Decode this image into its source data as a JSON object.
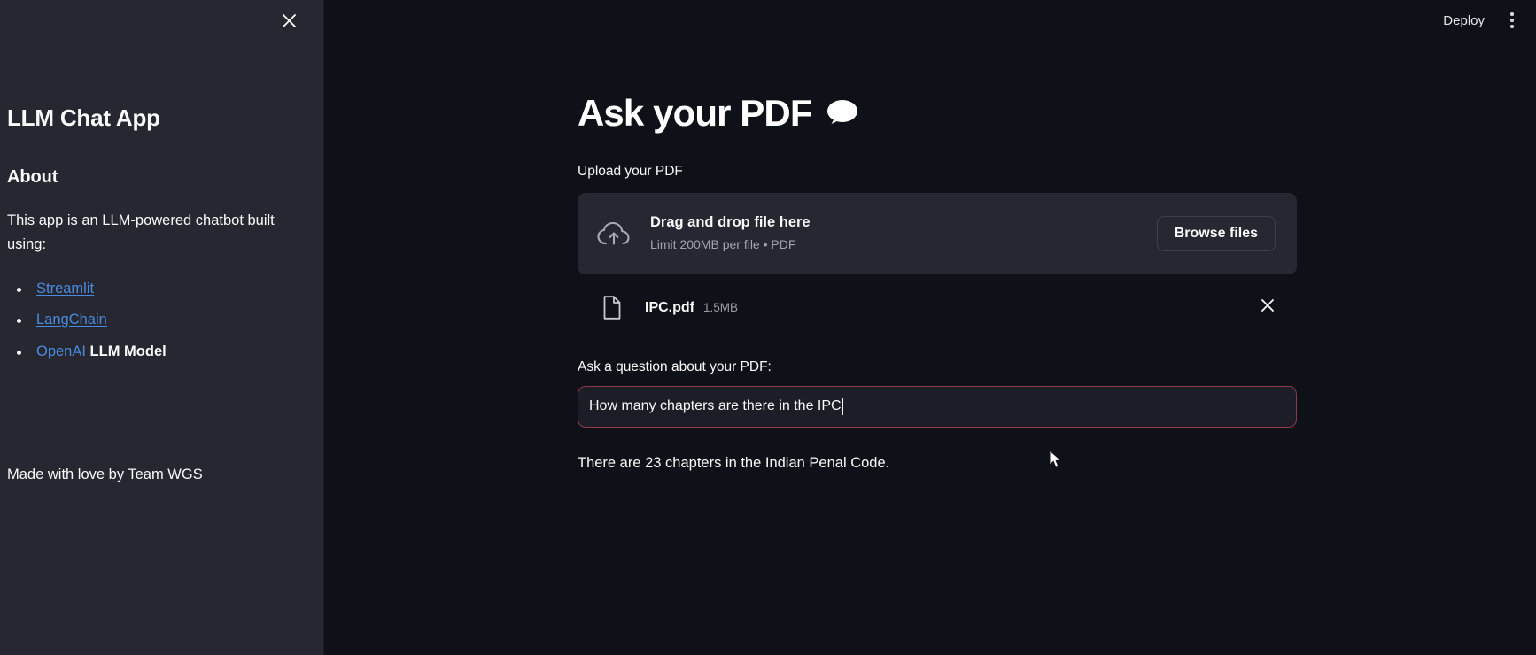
{
  "sidebar": {
    "close_icon": "close-icon",
    "app_title": "LLM Chat App",
    "about_heading": "About",
    "about_text": "This app is an LLM-powered chatbot built using:",
    "links": [
      {
        "label": "Streamlit",
        "suffix": ""
      },
      {
        "label": "LangChain",
        "suffix": ""
      },
      {
        "label": "OpenAI",
        "suffix": " LLM Model"
      }
    ],
    "footer": "Made with love by Team WGS",
    "link_color": "#4a8bdf",
    "background": "#262730"
  },
  "topbar": {
    "deploy_label": "Deploy",
    "menu_icon": "kebab-menu-icon"
  },
  "main": {
    "title": "Ask your PDF",
    "title_icon": "speech-balloon-icon",
    "upload_label": "Upload your PDF",
    "uploader": {
      "icon": "cloud-upload-icon",
      "drag_text": "Drag and drop file here",
      "limit_text": "Limit 200MB per file • PDF",
      "browse_label": "Browse files",
      "background": "#262730"
    },
    "file": {
      "icon": "document-icon",
      "name": "IPC.pdf",
      "size": "1.5MB",
      "remove_icon": "close-icon"
    },
    "question_label": "Ask a question about your PDF:",
    "question_value": "How many chapters are there in the IPC",
    "question_border_color": "#8b3b48",
    "answer": "There are 23 chapters in the Indian Penal Code.",
    "background": "#0e1117"
  }
}
